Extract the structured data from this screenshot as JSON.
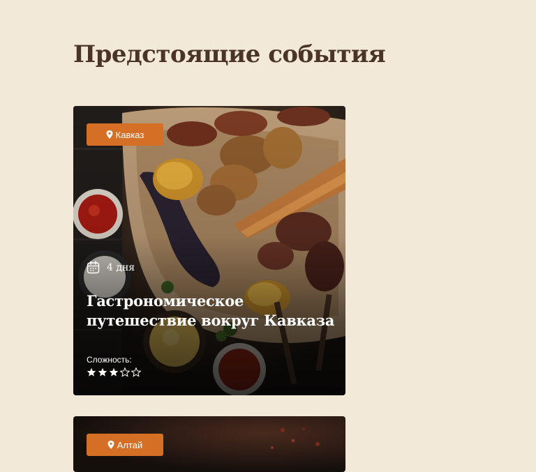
{
  "section": {
    "title": "Предстоящие события"
  },
  "cards": [
    {
      "location": "Кавказ",
      "duration": "4 дня",
      "title": "Гастрономическое путешествие вокруг Кавказа",
      "difficulty_label": "Сложность:",
      "difficulty": {
        "filled": 3,
        "total": 5
      }
    },
    {
      "location": "Алтай"
    }
  ],
  "icons": {
    "location": "map-pin-icon",
    "duration": "calendar-icon",
    "rating": "star-icon"
  },
  "colors": {
    "background": "#f2e9d8",
    "heading": "#4a3428",
    "badge": "#d46f25",
    "card_text": "#ffffff"
  }
}
